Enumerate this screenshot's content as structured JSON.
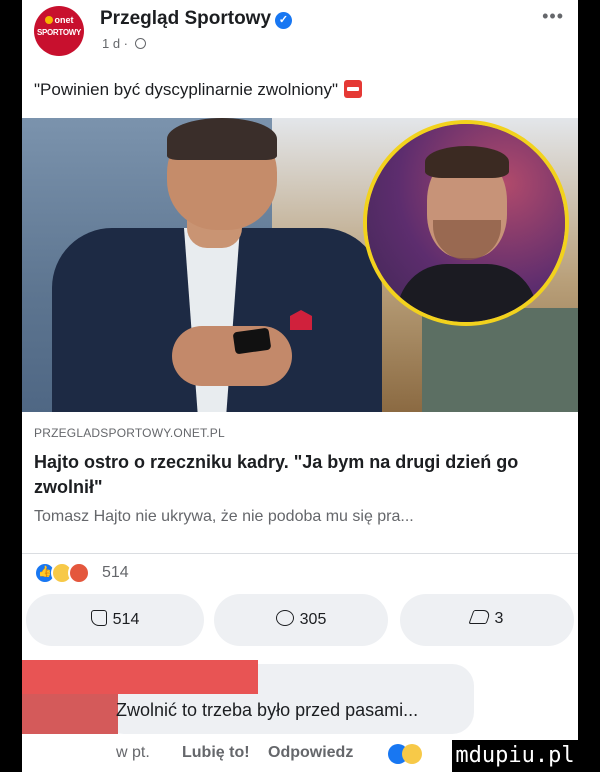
{
  "page": {
    "name": "Przegląd Sportowy",
    "time": "1 d ·",
    "avatar_top": "onet",
    "avatar_bottom": "SPORTOWY"
  },
  "post": {
    "text": "\"Powinien być dyscyplinarnie zwolniony\""
  },
  "link_preview": {
    "domain": "PRZEGLADSPORTOWY.ONET.PL",
    "title": "Hajto ostro o rzeczniku kadry. \"Ja bym na drugi dzień go zwolnił\"",
    "description": "Tomasz Hajto nie ukrywa, że nie podoba mu się pra..."
  },
  "reactions": {
    "count": "514",
    "types": [
      "like-icon",
      "haha-icon",
      "angry-icon"
    ]
  },
  "actions": {
    "like_count": "514",
    "comment_count": "305",
    "share_count": "3"
  },
  "comment": {
    "text": "Zwolnić to trzeba było przed pasami...",
    "time": "w pt.",
    "like_label": "Lubię to!",
    "reply_label": "Odpowiedz"
  },
  "watermark": "mdupiu.pl",
  "colors": {
    "accent": "#1877f2",
    "onet_red": "#c8102e",
    "inset_ring": "#f2d21d"
  }
}
